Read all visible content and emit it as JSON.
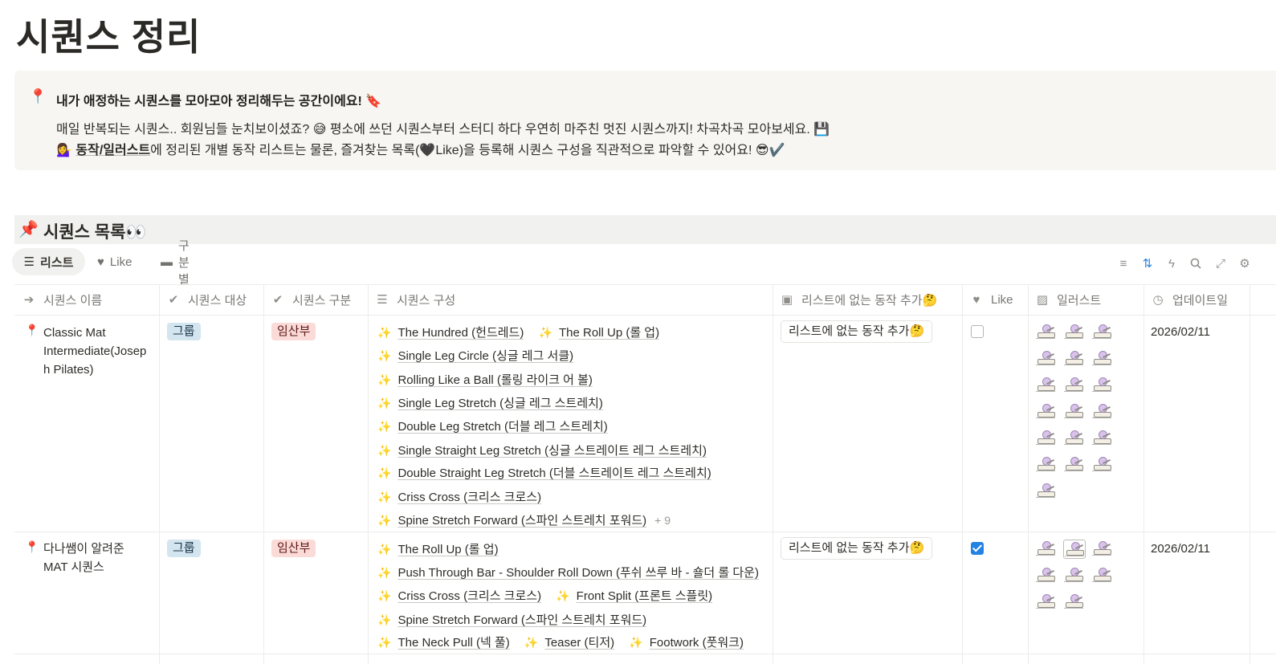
{
  "page": {
    "title": "시퀀스 정리"
  },
  "callout": {
    "icon": "📍",
    "title": "내가 애정하는 시퀀스를 모아모아 정리해두는 공간이에요! 🔖",
    "line1": "매일 반복되는 시퀀스.. 회원님들 눈치보이셨죠? 😅 평소에 쓰던 시퀀스부터 스터디 하다 우연히 마주친 멋진 시퀀스까지! 차곡차곡 모아보세요. 💾",
    "line2_icon": "💁‍♀️",
    "line2_link": "동작/일러스트",
    "line2_rest": "에 정리된 개별 동작 리스트는 물론, 즐겨찾는 목록(🖤Like)을 등록해 시퀀스 구성을 직관적으로 파악할 수 있어요! 😎✔️"
  },
  "database": {
    "icon": "📌",
    "title": "시퀀스 목록👀",
    "views": [
      {
        "label": "리스트",
        "icon": "☰"
      },
      {
        "label": "Like",
        "icon": "♥"
      },
      {
        "label": "구분별",
        "icon": "▬"
      }
    ],
    "toolbar_icons": [
      "filter-icon",
      "sort-icon",
      "lightning-icon",
      "search-icon",
      "expand-icon",
      "settings-icon"
    ],
    "columns": [
      {
        "label": "시퀀스 이름",
        "icon": "➔"
      },
      {
        "label": "시퀀스 대상",
        "icon": "✔"
      },
      {
        "label": "시퀀스 구분",
        "icon": "✔"
      },
      {
        "label": "시퀀스 구성",
        "icon": "☰"
      },
      {
        "label": "리스트에 없는 동작 추가🤔",
        "icon": "▣"
      },
      {
        "label": "Like",
        "icon": "♥"
      },
      {
        "label": "일러스트",
        "icon": "▨"
      },
      {
        "label": "업데이트일",
        "icon": "◷"
      }
    ],
    "rows": [
      {
        "icon": "📍",
        "name_lines": [
          "Classic Mat",
          "Intermediate(Josep",
          "h Pilates)"
        ],
        "target": "그룹",
        "category": "임산부",
        "sequence_lines": [
          [
            "The Hundred (헌드레드)",
            "The Roll Up (롤 업)"
          ],
          [
            "Single Leg Circle (싱글 레그 서클)"
          ],
          [
            "Rolling Like a Ball (롤링 라이크 어 볼)"
          ],
          [
            "Single Leg Stretch (싱글 레그 스트레치)"
          ],
          [
            "Double Leg Stretch (더블 레그 스트레치)"
          ],
          [
            "Single Straight Leg Stretch (싱글 스트레이트 레그 스트레치)"
          ],
          [
            "Double Straight Leg Stretch (더블 스트레이트 레그 스트레치)"
          ],
          [
            "Criss Cross (크리스 크로스)"
          ],
          [
            "Spine Stretch Forward (스파인 스트레치 포워드)"
          ]
        ],
        "more": "+ 9",
        "add_button": "리스트에 없는 동작 추가🤔",
        "like": false,
        "illustration_count": 19,
        "updated": "2026/02/11"
      },
      {
        "icon": "📍",
        "name_lines": [
          "다나쌤이 알려준",
          "MAT 시퀀스"
        ],
        "target": "그룹",
        "category": "임산부",
        "sequence_lines": [
          [
            "The Roll Up (롤 업)"
          ],
          [
            "Push Through Bar - Shoulder Roll Down (푸쉬 쓰루 바 - 숄더 롤 다운)"
          ],
          [
            "Criss Cross (크리스 크로스)",
            "Front Split (프론트 스플릿)"
          ],
          [
            "Spine Stretch Forward (스파인 스트레치 포워드)"
          ],
          [
            "The Neck Pull (넥 풀)",
            "Teaser (티저)",
            "Footwork (풋워크)"
          ]
        ],
        "more": "",
        "add_button": "리스트에 없는 동작 추가🤔",
        "like": true,
        "illustration_count": 8,
        "updated": "2026/02/11"
      }
    ]
  },
  "colors": {
    "accent": "#2383e2",
    "tag_blue": "#d3e5ef",
    "tag_red": "#fadbd8",
    "callout_bg": "#f7f6f3",
    "sparkle": "#f0b429"
  }
}
